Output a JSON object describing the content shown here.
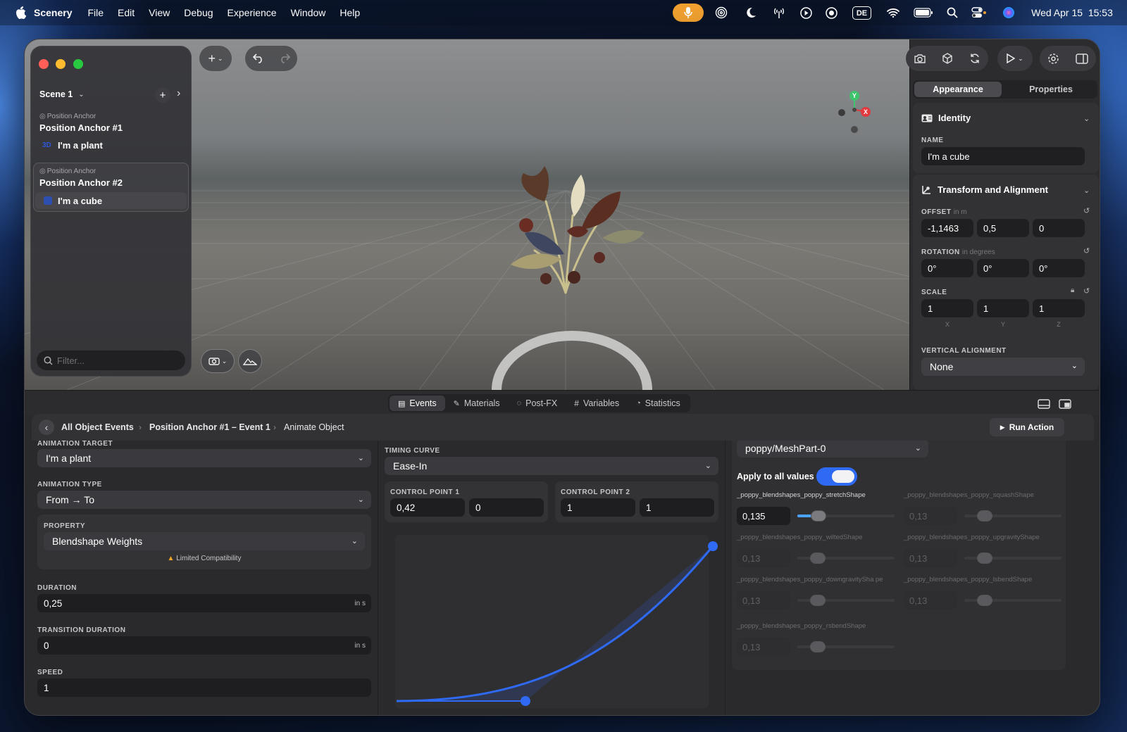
{
  "menubar": {
    "app": "Scenery",
    "items": [
      "File",
      "Edit",
      "View",
      "Debug",
      "Experience",
      "Window",
      "Help"
    ],
    "datetime": "Wed Apr 15  15:53",
    "keyboard": "DE",
    "icons": [
      "microphone-icon",
      "fingerprint-icon",
      "moon-icon",
      "antenna-icon",
      "play-circle-icon",
      "record-icon",
      "keyboard-de-icon",
      "wifi-icon",
      "battery-icon",
      "search-icon",
      "control-center-icon",
      "siri-icon"
    ]
  },
  "sidebar": {
    "scene": "Scene 1",
    "filter_placeholder": "Filter...",
    "anchors": [
      {
        "type": "Position Anchor",
        "name": "Position Anchor #1",
        "child": "I'm a plant",
        "child_icon": "3D"
      },
      {
        "type": "Position Anchor",
        "name": "Position Anchor #2",
        "child": "I'm a cube",
        "child_icon": "cube"
      }
    ]
  },
  "gizmo": {
    "y": "Y",
    "x": "X"
  },
  "inspector": {
    "tabs": [
      "Appearance",
      "Properties"
    ],
    "identity": {
      "title": "Identity",
      "name_label": "NAME",
      "name": "I'm a cube"
    },
    "transform": {
      "title": "Transform and Alignment",
      "offset_label": "OFFSET",
      "offset_unit": "in m",
      "offset": [
        "-1,1463",
        "0,5",
        "0"
      ],
      "rotation_label": "ROTATION",
      "rotation_unit": "in degrees",
      "rotation": [
        "0°",
        "0°",
        "0°"
      ],
      "scale_label": "SCALE",
      "scale": [
        "1",
        "1",
        "1"
      ],
      "axes": [
        "X",
        "Y",
        "Z"
      ],
      "valign_label": "VERTICAL ALIGNMENT",
      "valign": "None"
    }
  },
  "bottom_tabs": [
    "Events",
    "Materials",
    "Post-FX",
    "Variables",
    "Statistics"
  ],
  "breadcrumb": [
    "All Object Events",
    "Position Anchor #1 – Event 1",
    "Animate Object"
  ],
  "run_action": "Run Action",
  "left": {
    "target_label": "ANIMATION TARGET",
    "target": "I'm a plant",
    "type_label": "ANIMATION TYPE",
    "type": "From → To",
    "property_label": "PROPERTY",
    "property": "Blendshape Weights",
    "warning": "Limited Compatibility",
    "duration_label": "DURATION",
    "duration": "0,25",
    "unit_s": "in s",
    "transition_label": "TRANSITION DURATION",
    "transition": "0",
    "speed_label": "SPEED",
    "speed": "1"
  },
  "middle": {
    "curve_label": "TIMING CURVE",
    "curve": "Ease-In",
    "cp1_label": "CONTROL POINT 1",
    "cp1": [
      "0,42",
      "0"
    ],
    "cp2_label": "CONTROL POINT 2",
    "cp2": [
      "1",
      "1"
    ]
  },
  "right": {
    "mesh": "poppy/MeshPart-0",
    "apply_all_label": "Apply to all values",
    "apply_all": true,
    "shapes": [
      {
        "name": "_poppy_blendshapes_poppy_stretchShape",
        "value": "0,135",
        "level": 0.135,
        "active": true
      },
      {
        "name": "_poppy_blendshapes_poppy_squashShape",
        "value": "0,13",
        "level": 0.13,
        "active": false
      },
      {
        "name": "_poppy_blendshapes_poppy_wiltedShape",
        "value": "0,13",
        "level": 0.13,
        "active": false
      },
      {
        "name": "_poppy_blendshapes_poppy_upgravityShape",
        "value": "0,13",
        "level": 0.13,
        "active": false
      },
      {
        "name": "_poppy_blendshapes_poppy_downgravitySha pe",
        "value": "0,13",
        "level": 0.13,
        "active": false
      },
      {
        "name": "_poppy_blendshapes_poppy_lsbendShape",
        "value": "0,13",
        "level": 0.13,
        "active": false
      },
      {
        "name": "_poppy_blendshapes_poppy_rsbendShape",
        "value": "0,13",
        "level": 0.13,
        "active": false
      }
    ]
  },
  "colors": {
    "accent": "#2f6af5",
    "close": "#ff5f57",
    "minimize": "#febc2e",
    "zoom": "#28c840",
    "gizmo_y": "#3ec46d",
    "gizmo_x": "#e0393e",
    "warning": "#f5a623"
  }
}
